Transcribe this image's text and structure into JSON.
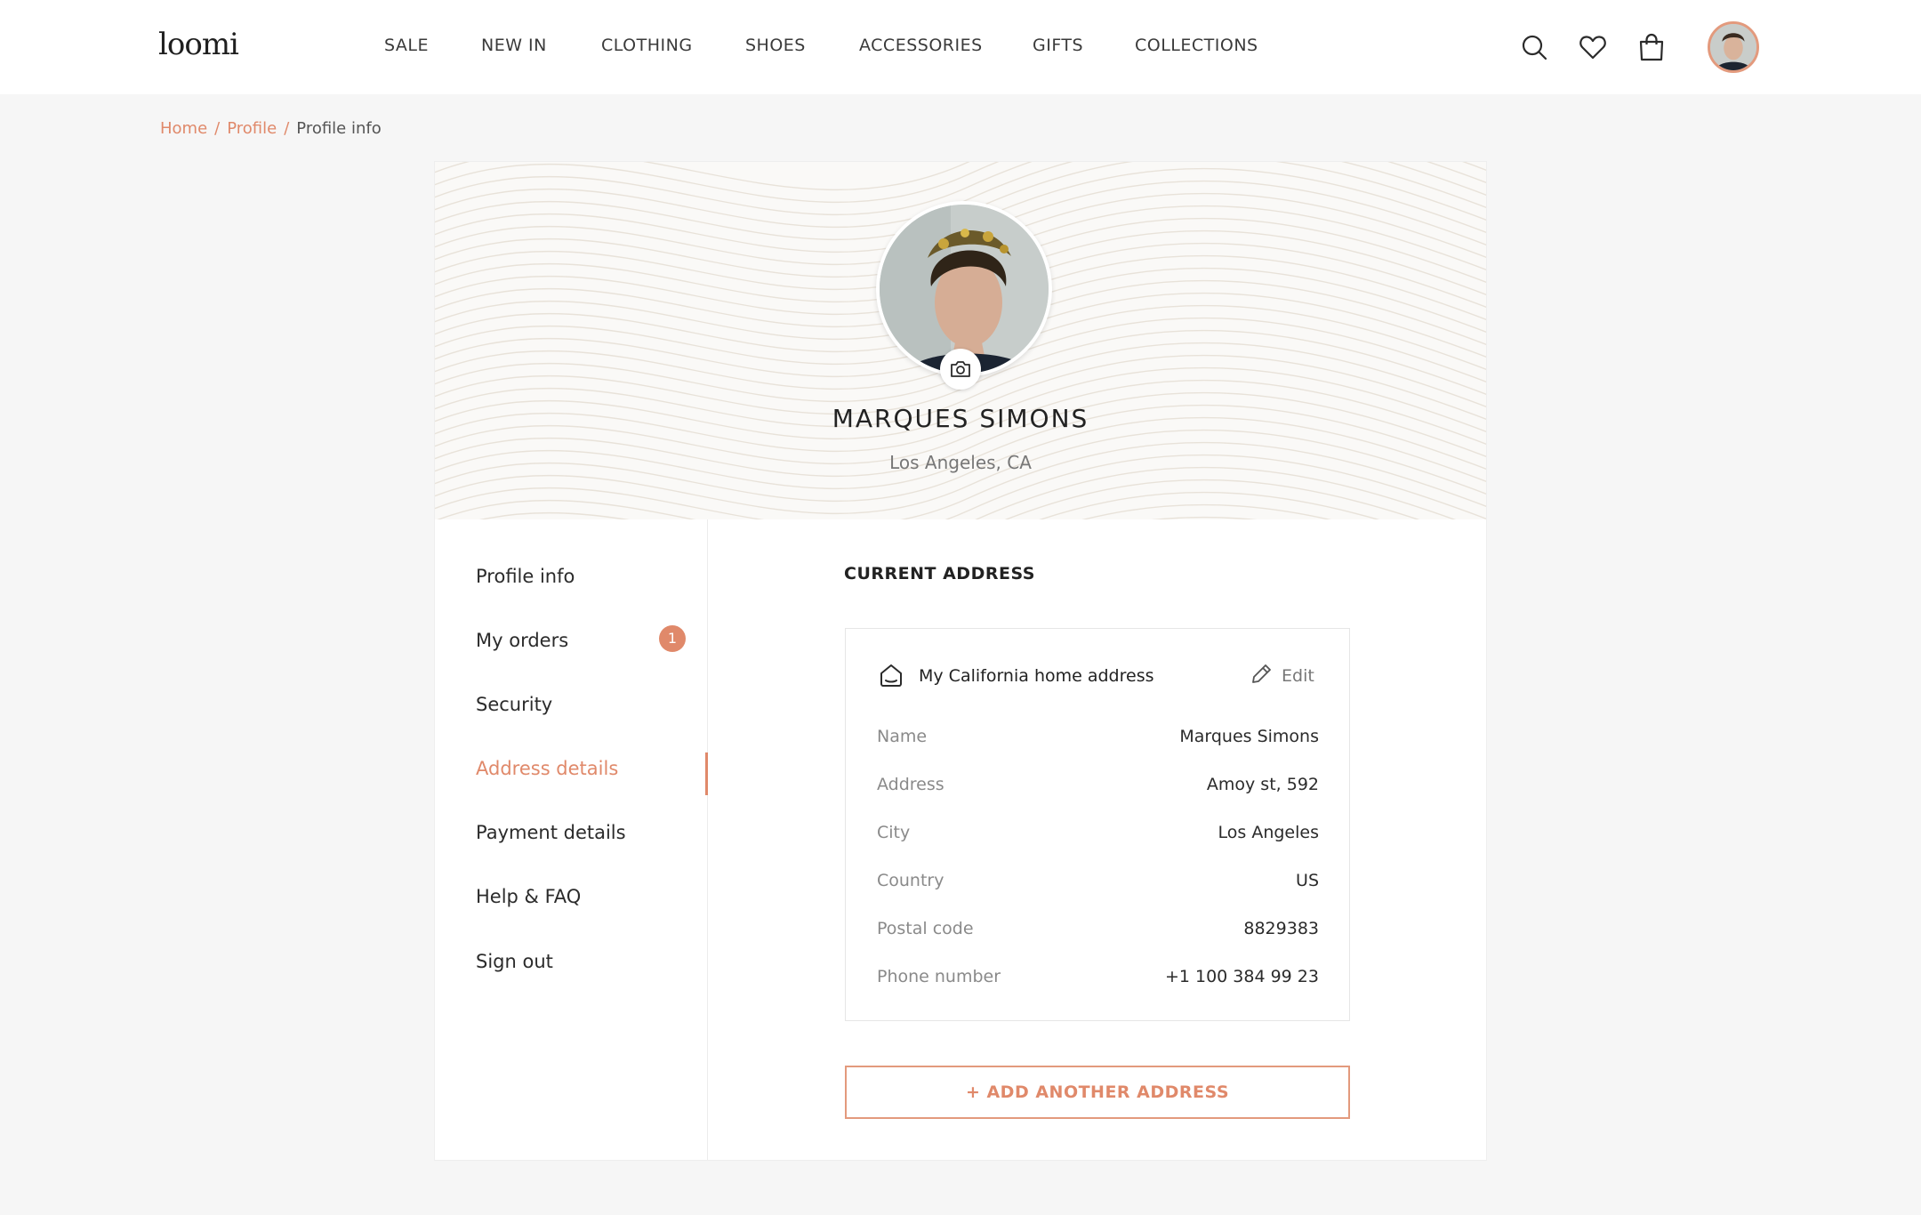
{
  "header": {
    "logo": "loomi",
    "nav": [
      "SALE",
      "NEW IN",
      "CLOTHING",
      "SHOES",
      "ACCESSORIES",
      "GIFTS",
      "COLLECTIONS"
    ],
    "icons": [
      "search-icon",
      "heart-icon",
      "shopping-bag-icon",
      "user-avatar"
    ]
  },
  "breadcrumb": {
    "home": "Home",
    "profile": "Profile",
    "current": "Profile info",
    "separator": "/"
  },
  "profile": {
    "name": "MARQUES SIMONS",
    "location": "Los Angeles, CA",
    "photo_button_icon": "camera-icon"
  },
  "sidebar": {
    "items": [
      {
        "label": "Profile info"
      },
      {
        "label": "My orders",
        "badge": "1"
      },
      {
        "label": "Security"
      },
      {
        "label": "Address details"
      },
      {
        "label": "Payment details"
      },
      {
        "label": "Help & FAQ"
      },
      {
        "label": "Sign out"
      }
    ],
    "active": "Address details"
  },
  "address": {
    "section_title": "CURRENT ADDRESS",
    "card_title": "My California home address",
    "edit_label": "Edit",
    "rows": [
      {
        "label": "Name",
        "value": "Marques Simons"
      },
      {
        "label": "Address",
        "value": "Amoy st, 592"
      },
      {
        "label": "City",
        "value": "Los Angeles"
      },
      {
        "label": "Country",
        "value": "US"
      },
      {
        "label": "Postal code",
        "value": "8829383"
      },
      {
        "label": "Phone number",
        "value": "+1 100 384 99 23"
      }
    ],
    "add_button": "+ ADD ANOTHER ADDRESS"
  },
  "colors": {
    "accent": "#e0896a",
    "background": "#f6f6f6",
    "text": "#2b2b2b",
    "muted": "#8a8a8a"
  }
}
